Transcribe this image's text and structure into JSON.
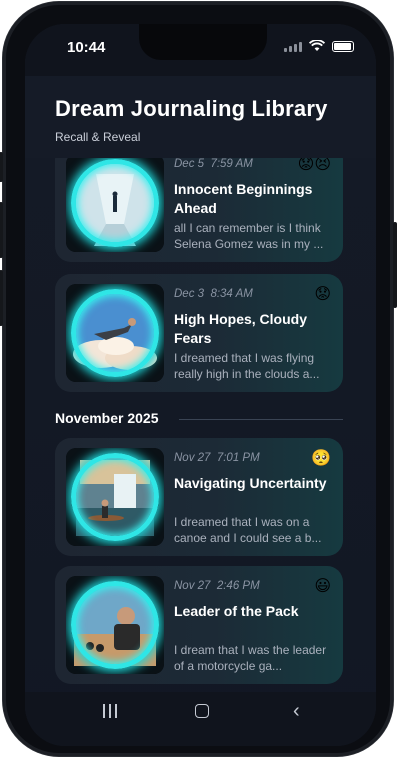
{
  "status": {
    "time": "10:44"
  },
  "header": {
    "title": "Dream Journaling Library",
    "subtitle": "Recall & Reveal"
  },
  "entries": [
    {
      "date": "Dec 5",
      "time": "7:59 AM",
      "emoji": "😟😣",
      "title": "Innocent Beginnings Ahead",
      "preview": "all I can remember is I think Selena Gomez was in my ..."
    },
    {
      "date": "Dec 3",
      "time": "8:34 AM",
      "emoji": "😟",
      "title": "High Hopes, Cloudy Fears",
      "preview": "I dreamed that I was flying really high in the clouds a..."
    },
    {
      "date": "Nov 27",
      "time": "7:01 PM",
      "emoji": "🥺",
      "title": "Navigating Uncertainty",
      "preview": "I dreamed that I was on a canoe and I could see a b..."
    },
    {
      "date": "Nov 27",
      "time": "2:46 PM",
      "emoji": "😃",
      "title": "Leader of the Pack",
      "preview": "I dream that I was the leader of a motorcycle ga..."
    }
  ],
  "section": {
    "month": "November 2025"
  },
  "colors": {
    "accent": "#2fe6e6",
    "background": "#131925"
  },
  "icons": {
    "recent": "recent-apps-icon",
    "home": "home-icon",
    "back": "back-icon"
  }
}
